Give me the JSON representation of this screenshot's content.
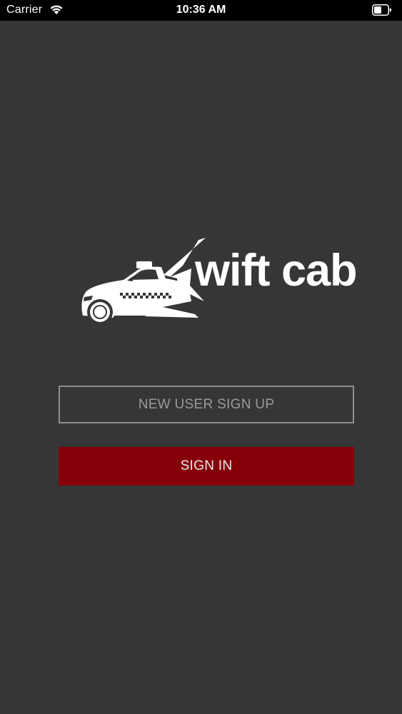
{
  "status_bar": {
    "carrier": "Carrier",
    "time": "10:36 AM",
    "icons": [
      "wifi-icon",
      "battery-icon"
    ]
  },
  "logo": {
    "text": "wift cab",
    "icon": "taxi-car-logo-icon"
  },
  "buttons": {
    "signup_label": "NEW USER SIGN UP",
    "signin_label": "SIGN IN"
  },
  "colors": {
    "background": "#363537",
    "status_bar": "#000000",
    "signin_button": "#86000a",
    "signup_border": "#8f8f91",
    "signup_text": "#9a9a9c"
  }
}
